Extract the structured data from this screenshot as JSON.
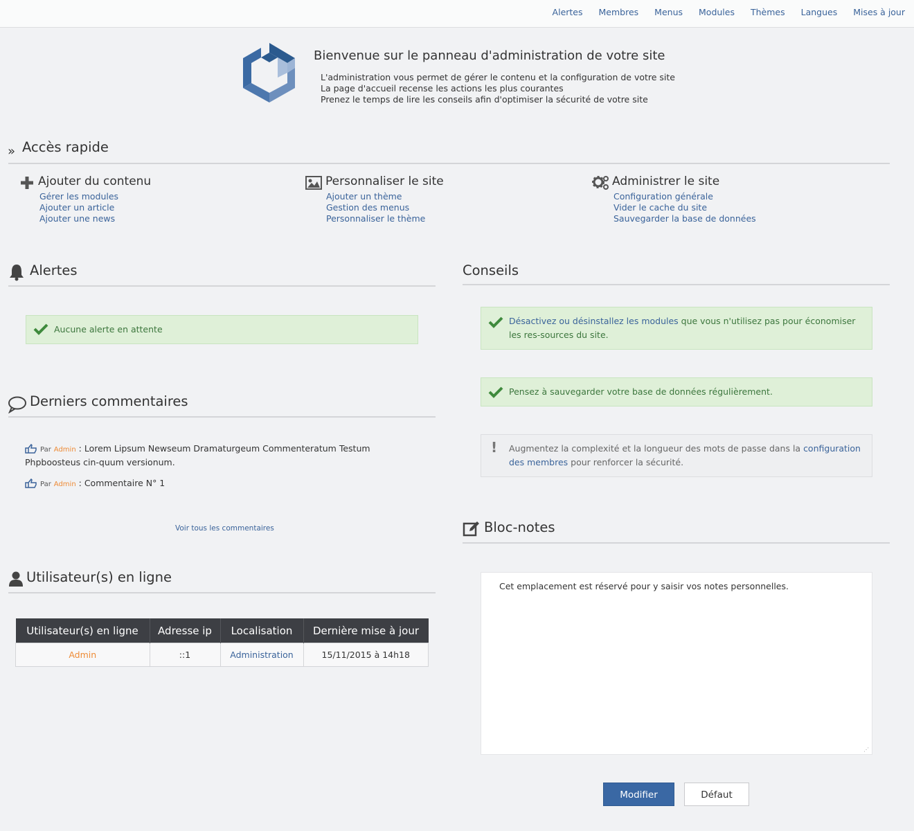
{
  "topnav": [
    "Alertes",
    "Membres",
    "Menus",
    "Modules",
    "Thèmes",
    "Langues",
    "Mises à jour"
  ],
  "welcome": {
    "title": "Bienvenue sur le panneau d'administration de votre site",
    "lines": [
      "L'administration vous permet de gérer le contenu et la configuration de votre site",
      "La page d'accueil recense les actions les plus courantes",
      "Prenez le temps de lire les conseils afin d'optimiser la sécurité de votre site"
    ]
  },
  "quick_access": {
    "title": "Accès rapide",
    "columns": [
      {
        "icon": "plus-icon",
        "title": "Ajouter du contenu",
        "links": [
          "Gérer les modules",
          "Ajouter un article",
          "Ajouter une news"
        ]
      },
      {
        "icon": "image-icon",
        "title": "Personnaliser le site",
        "links": [
          "Ajouter un thème",
          "Gestion des menus",
          "Personnaliser le thème"
        ]
      },
      {
        "icon": "gears-icon",
        "title": "Administrer le site",
        "links": [
          "Configuration générale",
          "Vider le cache du site",
          "Sauvegarder la base de données"
        ]
      }
    ]
  },
  "alerts": {
    "title": "Alertes",
    "message": "Aucune alerte en attente"
  },
  "tips": {
    "title": "Conseils",
    "tip1": {
      "link": "Désactivez ou désinstallez les modules",
      "text": " que vous n'utilisez pas pour économiser les res-sources du site."
    },
    "tip2": {
      "text": "Pensez à sauvegarder votre base de données régulièrement."
    },
    "tip3": {
      "text_before": "Augmentez la complexité et la longueur des mots de passe dans la ",
      "link": "configuration des membres",
      "text_after": " pour renforcer la sécurité."
    }
  },
  "comments": {
    "title": "Derniers commentaires",
    "by_label": "Par",
    "items": [
      {
        "author": "Admin",
        "text": " : Lorem Lipsum Newseum Dramaturgeum Commenteratum Testum Phpboosteus cin-quum versionum."
      },
      {
        "author": "Admin",
        "text": " : Commentaire N° 1"
      }
    ],
    "see_all": "Voir tous les commentaires"
  },
  "notepad": {
    "title": "Bloc-notes",
    "content": "Cet emplacement est réservé pour y saisir vos notes personnelles.",
    "modify_label": "Modifier",
    "default_label": "Défaut"
  },
  "online_users": {
    "title": "Utilisateur(s) en ligne",
    "columns": [
      "Utilisateur(s) en ligne",
      "Adresse ip",
      "Localisation",
      "Dernière mise à jour"
    ],
    "rows": [
      {
        "user": "Admin",
        "ip": "::1",
        "location": "Administration",
        "updated": "15/11/2015 à 14h18"
      }
    ]
  },
  "colors": {
    "link": "#3a639a",
    "author": "#ee8b36",
    "success_bg": "#dff0d8",
    "button": "#3a68a4"
  }
}
